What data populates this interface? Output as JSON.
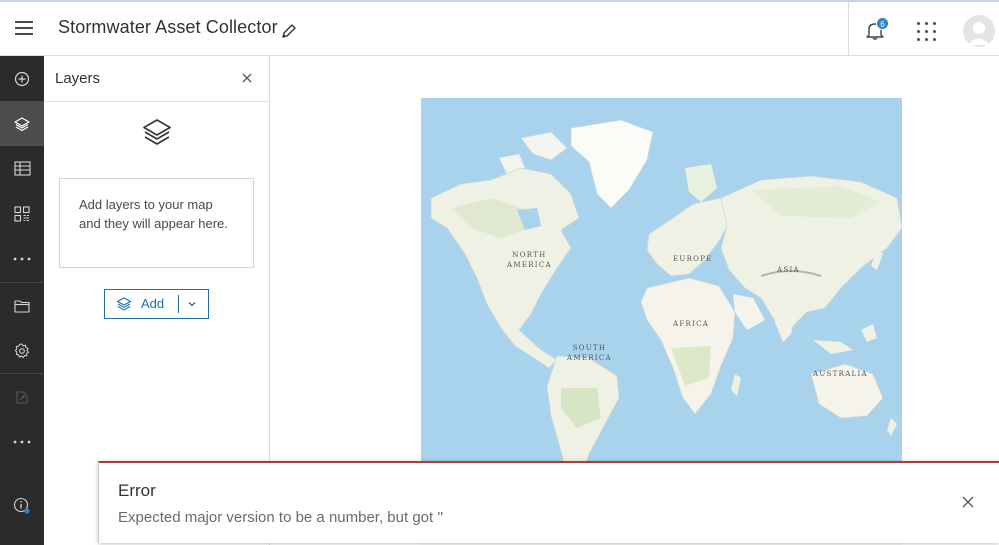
{
  "header": {
    "title": "Stormwater Asset Collector",
    "notification_count": "6",
    "icons": [
      "menu-icon",
      "pencil-icon",
      "bell-icon",
      "apps-grid-icon",
      "user-avatar"
    ]
  },
  "sidebar": {
    "items": [
      {
        "name": "add-content",
        "icon": "plus-circle-icon"
      },
      {
        "name": "layers",
        "icon": "layers-icon",
        "active": true
      },
      {
        "name": "table",
        "icon": "table-icon"
      },
      {
        "name": "widgets",
        "icon": "widgets-icon"
      },
      {
        "name": "more",
        "icon": "ellipsis-icon"
      },
      {
        "name": "folder",
        "icon": "folder-icon"
      },
      {
        "name": "settings",
        "icon": "gear-icon"
      },
      {
        "name": "share",
        "icon": "share-icon",
        "disabled": true
      },
      {
        "name": "more-2",
        "icon": "ellipsis-icon"
      },
      {
        "name": "info",
        "icon": "info-icon"
      }
    ]
  },
  "layers_panel": {
    "title": "Layers",
    "empty_message": "Add layers to your map and they will appear here.",
    "add_label": "Add"
  },
  "map": {
    "labels": [
      "NORTH\nAMERICA",
      "EUROPE",
      "ASIA",
      "AFRICA",
      "SOUTH\nAMERICA",
      "AUSTRALIA"
    ]
  },
  "error_toast": {
    "title": "Error",
    "message": "Expected major version to be a number, but got ''"
  },
  "colors": {
    "accent": "#1f6ea5",
    "error": "#b33a3a",
    "sidebar_bg": "#2b2b2b",
    "ocean": "#a9d3ec"
  }
}
